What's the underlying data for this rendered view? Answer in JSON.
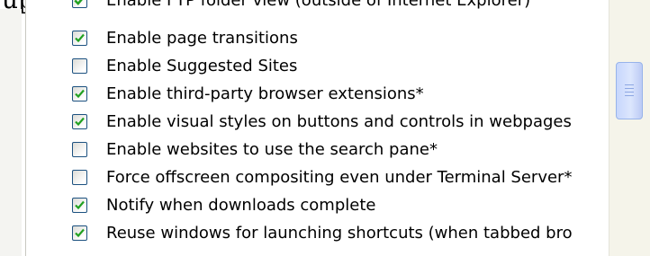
{
  "top_fragment": "up.",
  "cropped_item": {
    "label": "Enable FTP folder view (outside of Internet Explorer)",
    "checked": true
  },
  "items": [
    {
      "label": "Enable page transitions",
      "checked": true
    },
    {
      "label": "Enable Suggested Sites",
      "checked": false
    },
    {
      "label": "Enable third-party browser extensions*",
      "checked": true
    },
    {
      "label": "Enable visual styles on buttons and controls in webpages",
      "checked": true
    },
    {
      "label": "Enable websites to use the search pane*",
      "checked": false
    },
    {
      "label": "Force offscreen compositing even under Terminal Server*",
      "checked": false
    },
    {
      "label": "Notify when downloads complete",
      "checked": true
    },
    {
      "label": "Reuse windows for launching shortcuts (when tabbed bro",
      "checked": true
    }
  ],
  "icons": {
    "checkmark": "check-icon",
    "scroll_grip": "scroll-grip-icon"
  },
  "colors": {
    "checkmark": "#21a121",
    "checkbox_border": "#1c5180",
    "scrollbar_track": "#f5f4ea",
    "scrollbar_thumb": "#c7d7fd"
  }
}
